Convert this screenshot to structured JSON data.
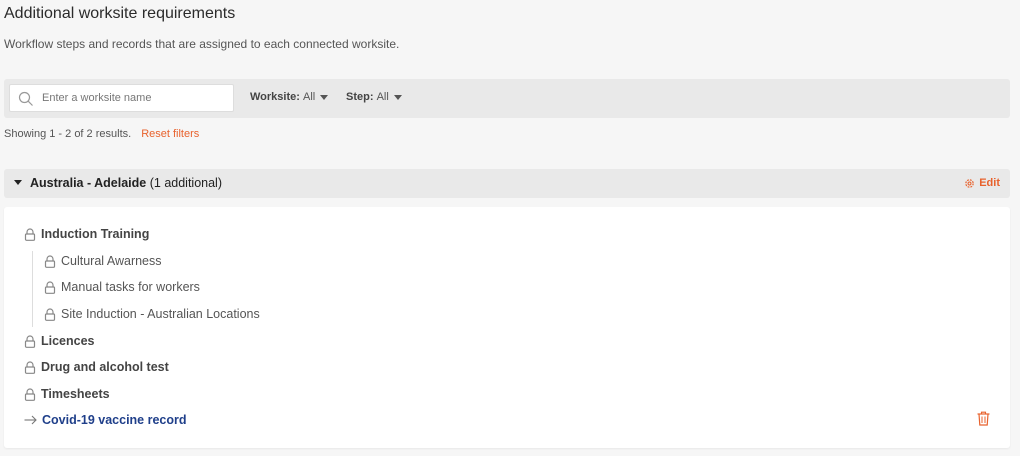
{
  "header": {
    "title": "Additional worksite requirements",
    "subtitle": "Workflow steps and records that are assigned to each connected worksite."
  },
  "filters": {
    "search_placeholder": "Enter a worksite name",
    "worksite_label": "Worksite:",
    "worksite_value": "All",
    "step_label": "Step:",
    "step_value": "All"
  },
  "results": {
    "text": "Showing 1 - 2 of 2 results.",
    "reset_label": "Reset filters"
  },
  "group": {
    "name": "Australia - Adelaide",
    "extra": "(1 additional)",
    "edit_label": "Edit",
    "items": [
      {
        "label": "Induction Training"
      },
      {
        "label": "Cultural Awarness"
      },
      {
        "label": "Manual tasks for workers"
      },
      {
        "label": "Site Induction - Australian Locations"
      },
      {
        "label": "Licences"
      },
      {
        "label": "Drug and alcohol test"
      },
      {
        "label": "Timesheets"
      },
      {
        "label": "Covid-19 vaccine record"
      }
    ]
  },
  "colors": {
    "accent": "#e8622d",
    "link": "#1f3f8a",
    "panel": "#e9e9e9",
    "background": "#f6f6f6"
  }
}
